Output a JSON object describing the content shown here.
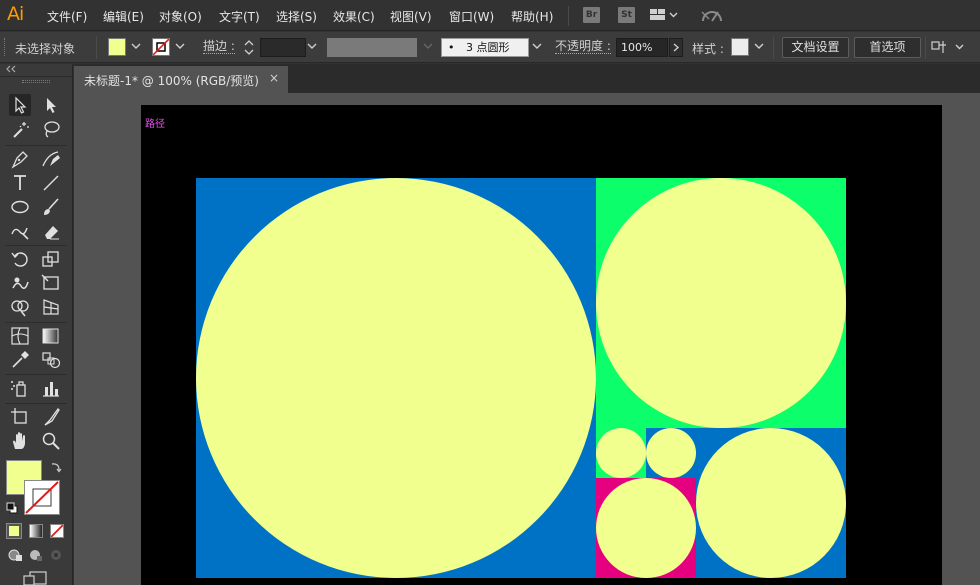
{
  "app": {
    "logo": "Ai",
    "menus": [
      "文件(F)",
      "编辑(E)",
      "对象(O)",
      "文字(T)",
      "选择(S)",
      "效果(C)",
      "视图(V)",
      "窗口(W)",
      "帮助(H)"
    ],
    "bridge_badge": "Br",
    "stock_badge": "St"
  },
  "control": {
    "selection_status": "未选择对象",
    "stroke_label": "描边 :",
    "brush_value": "3 点圆形",
    "brush_bullet": "•",
    "opacity_label": "不透明度 :",
    "opacity_value": "100%",
    "style_label": "样式 :",
    "doc_settings_button": "文档设置",
    "preferences_button": "首选项"
  },
  "tab": {
    "title": "未标题-1* @ 100% (RGB/预览)",
    "close": "×"
  },
  "canvas": {
    "path_label": "路径"
  },
  "colors": {
    "fill": "#f1ff8e",
    "blue": "#0072c6",
    "green": "#0cff6a",
    "magenta": "#e5007f",
    "artboard": "#000000",
    "accent_logo": "#ff9a00",
    "path_label": "#e84ef2"
  },
  "icons": {
    "selection": "selection-tool-icon",
    "direct_selection": "direct-selection-tool-icon",
    "magic_wand": "magic-wand-icon",
    "lasso": "lasso-icon",
    "pen": "pen-tool-icon",
    "curvature": "curvature-tool-icon",
    "type": "type-tool-icon",
    "line": "line-tool-icon",
    "ellipse": "ellipse-tool-icon",
    "paintbrush": "paintbrush-icon",
    "shaper": "shaper-tool-icon",
    "eraser": "eraser-icon",
    "rotate": "rotate-tool-icon",
    "scale": "scale-tool-icon",
    "warp": "warp-tool-icon",
    "free_transform": "free-transform-icon",
    "shape_builder": "shape-builder-icon",
    "perspective": "perspective-grid-icon",
    "mesh": "mesh-tool-icon",
    "gradient": "gradient-tool-icon",
    "eyedropper": "eyedropper-icon",
    "blend": "blend-tool-icon",
    "symbol_sprayer": "symbol-sprayer-icon",
    "graph": "graph-tool-icon",
    "artboard": "artboard-tool-icon",
    "slice": "slice-tool-icon",
    "hand": "hand-tool-icon",
    "zoom": "zoom-tool-icon"
  }
}
